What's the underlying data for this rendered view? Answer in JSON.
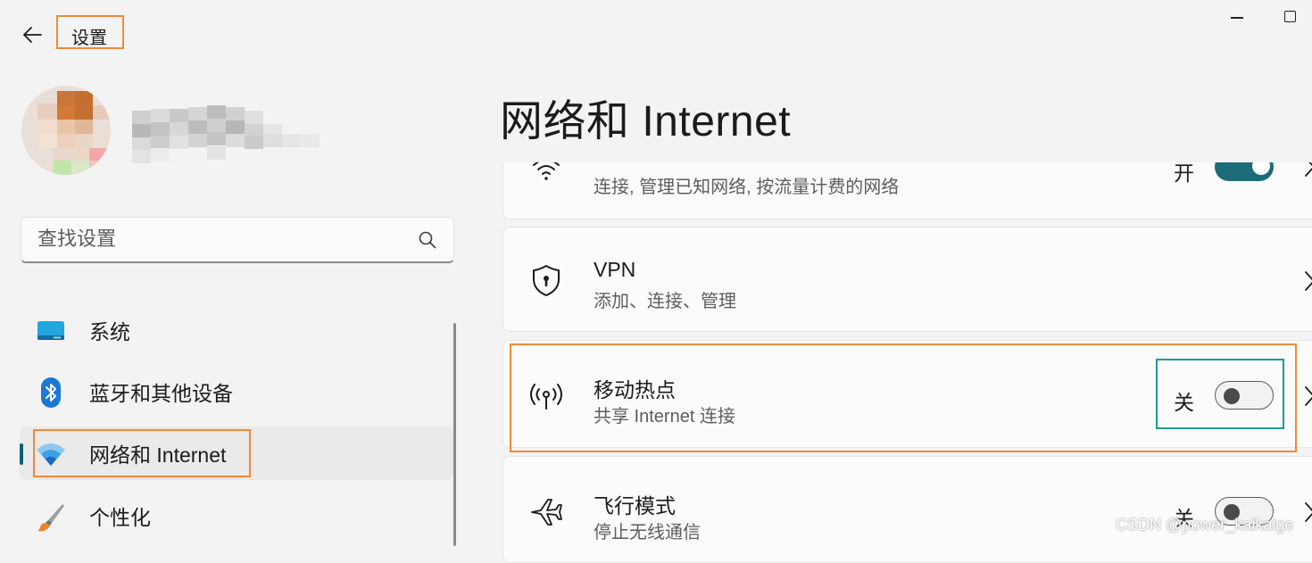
{
  "window": {
    "title": "设置",
    "controls": [
      "minimize",
      "maximize"
    ]
  },
  "profile": {
    "user_name": ""
  },
  "search": {
    "placeholder": "查找设置",
    "value": "",
    "icon": "search-icon"
  },
  "sidebar": {
    "items": [
      {
        "label": "系统",
        "icon": "system-monitor-icon",
        "active": false
      },
      {
        "label": "蓝牙和其他设备",
        "icon": "bluetooth-icon",
        "active": false
      },
      {
        "label": "网络和 Internet",
        "icon": "wifi-icon",
        "active": true
      },
      {
        "label": "个性化",
        "icon": "paintbrush-icon",
        "active": false
      }
    ]
  },
  "main": {
    "title": "网络和 Internet",
    "cards": [
      {
        "name": "wlan",
        "title": "",
        "subtitle": "连接, 管理已知网络, 按流量计费的网络",
        "icon": "wifi-icon",
        "toggle_label": "开",
        "toggle_on": true
      },
      {
        "name": "vpn",
        "title": "VPN",
        "subtitle": "添加、连接、管理",
        "icon": "shield-icon"
      },
      {
        "name": "mobile-hotspot",
        "title": "移动热点",
        "subtitle": "共享 Internet 连接",
        "icon": "hotspot-icon",
        "toggle_label": "关",
        "toggle_on": false
      },
      {
        "name": "airplane-mode",
        "title": "飞行模式",
        "subtitle": "停止无线通信",
        "icon": "airplane-icon",
        "toggle_label": "关",
        "toggle_on": false
      }
    ]
  },
  "watermark": "CSDN @power_kaikaige",
  "colors": {
    "accent": "#1d6b78",
    "annotation_orange": "#ef8a3a",
    "annotation_teal": "#1f9a96",
    "background": "#f3f3f3",
    "card": "#fbfbfb"
  }
}
